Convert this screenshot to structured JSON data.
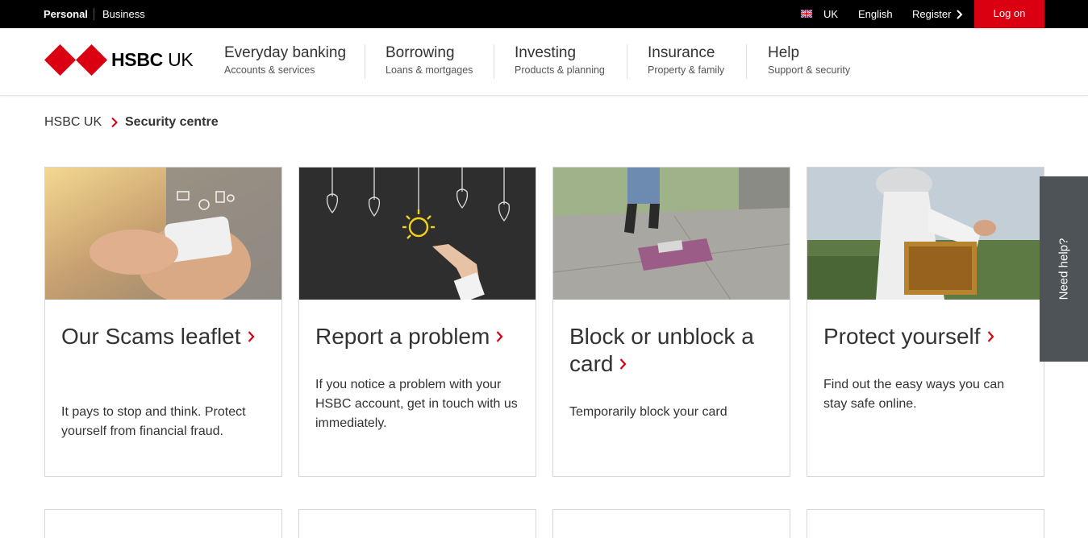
{
  "topbar": {
    "personal": "Personal",
    "business": "Business",
    "region": "UK",
    "language": "English",
    "register": "Register",
    "logon": "Log on"
  },
  "header": {
    "logo_brand": "HSBC",
    "logo_suffix": "UK",
    "nav": [
      {
        "title": "Everyday banking",
        "sub": "Accounts & services"
      },
      {
        "title": "Borrowing",
        "sub": "Loans & mortgages"
      },
      {
        "title": "Investing",
        "sub": "Products & planning"
      },
      {
        "title": "Insurance",
        "sub": "Property & family"
      },
      {
        "title": "Help",
        "sub": "Support & security"
      }
    ]
  },
  "breadcrumb": {
    "home": "HSBC UK",
    "current": "Security centre"
  },
  "cards": [
    {
      "title": "Our Scams leaflet",
      "desc": "It pays to stop and think. Protect yourself from financial fraud.",
      "image": "person-using-smartphone-photo"
    },
    {
      "title": "Report a problem",
      "desc": "If you notice a problem with your HSBC account, get in touch with us immediately.",
      "image": "lightbulb-chalkboard-photo"
    },
    {
      "title": "Block or unblock a card",
      "desc": "Temporarily block your card",
      "image": "dropped-wallet-photo"
    },
    {
      "title": "Protect yourself",
      "desc": "Find out the easy ways you can stay safe online.",
      "image": "beekeeper-photo"
    }
  ],
  "need_help": "Need help?",
  "colors": {
    "brand_red": "#db0011",
    "topbar_bg": "#000000",
    "help_tab_bg": "#4d5356"
  }
}
